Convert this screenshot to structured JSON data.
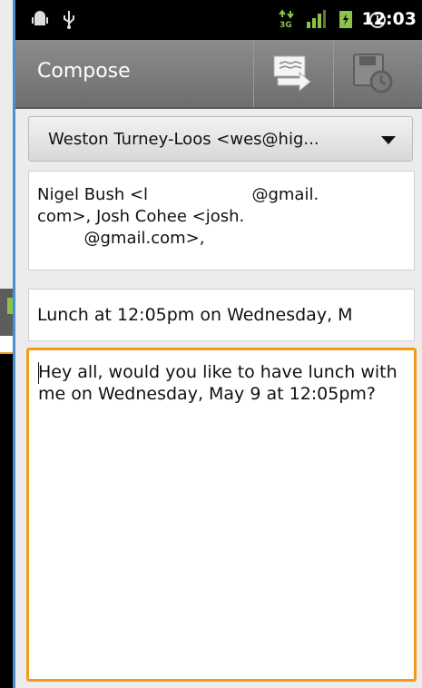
{
  "status_bar": {
    "time": "12:03",
    "icons": [
      "android-debug-icon",
      "usb-icon",
      "3g-icon",
      "signal-icon",
      "battery-charging-icon",
      "alarm-icon"
    ]
  },
  "action_bar": {
    "title": "Compose",
    "buttons": [
      {
        "name": "send-icon"
      },
      {
        "name": "save-draft-icon"
      }
    ]
  },
  "compose": {
    "from": "Weston Turney-Loos <wes@hig...",
    "to": "Nigel Bush <l                    @gmail.\ncom>, Josh Cohee <josh.\n         @gmail.com>,",
    "subject": "Lunch at 12:05pm on Wednesday, M",
    "body": "Hey all, would you like to have lunch with me on Wednesday, May 9 at 12:05pm?"
  },
  "colors": {
    "focus_border": "#f39a1b",
    "accent_border": "#4a8fd0",
    "status_bar": "#000000",
    "action_bar": "#7a7a7a"
  }
}
